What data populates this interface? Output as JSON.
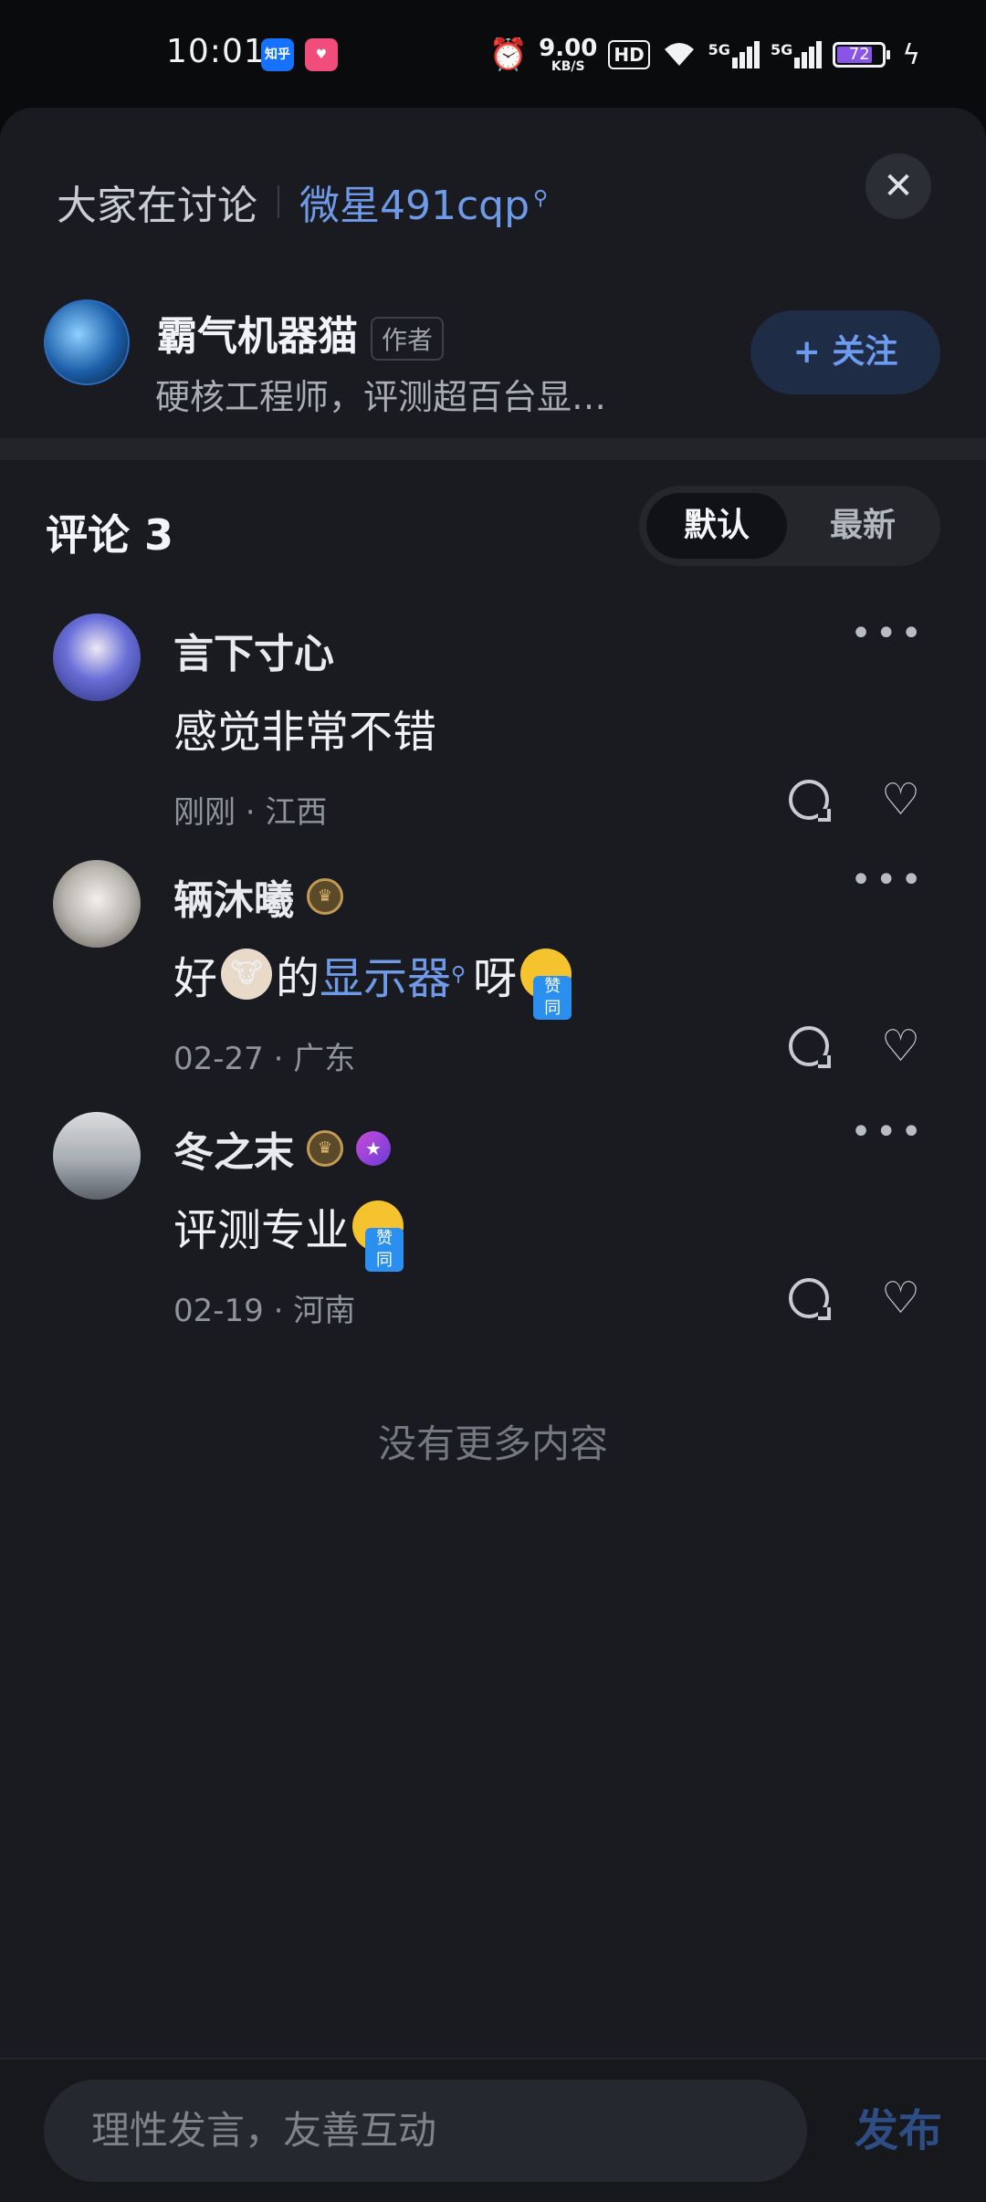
{
  "status_bar": {
    "time": "10:01",
    "app_icons": [
      "知乎",
      "ᐃᐃᐃ"
    ],
    "net_speed_value": "9.00",
    "net_speed_unit": "KB/S",
    "hd_label": "HD",
    "signal_label": "5G",
    "battery_level": "72",
    "icons": [
      "alarm-icon",
      "wifi-icon",
      "signal-icon",
      "battery-icon",
      "charging-icon"
    ]
  },
  "header": {
    "discussion_label": "大家在讨论",
    "topic_link": "微星491cqp"
  },
  "author": {
    "name": "霸气机器猫",
    "tag": "作者",
    "description": "硬核工程师，评测超百台显…",
    "follow_label": "+ 关注"
  },
  "comments_header": {
    "title": "评论 3",
    "sort_default": "默认",
    "sort_latest": "最新"
  },
  "comments": [
    {
      "name": "言下寸心",
      "text": "感觉非常不错",
      "meta": "刚刚 · 江西"
    },
    {
      "name": "辆沐曦",
      "text_prefix": "好",
      "text_mid": "的",
      "text_link": "显示器",
      "text_suffix": "呀",
      "meta": "02-27 · 广东"
    },
    {
      "name": "冬之末",
      "text": "评测专业",
      "meta": "02-19 · 河南"
    }
  ],
  "footer_note": "没有更多内容",
  "composer": {
    "placeholder": "理性发言，友善互动",
    "publish_label": "发布"
  },
  "colors": {
    "background": "#191b20",
    "accent_link": "#6e9ae8",
    "follow_bg": "#1f2c46"
  }
}
